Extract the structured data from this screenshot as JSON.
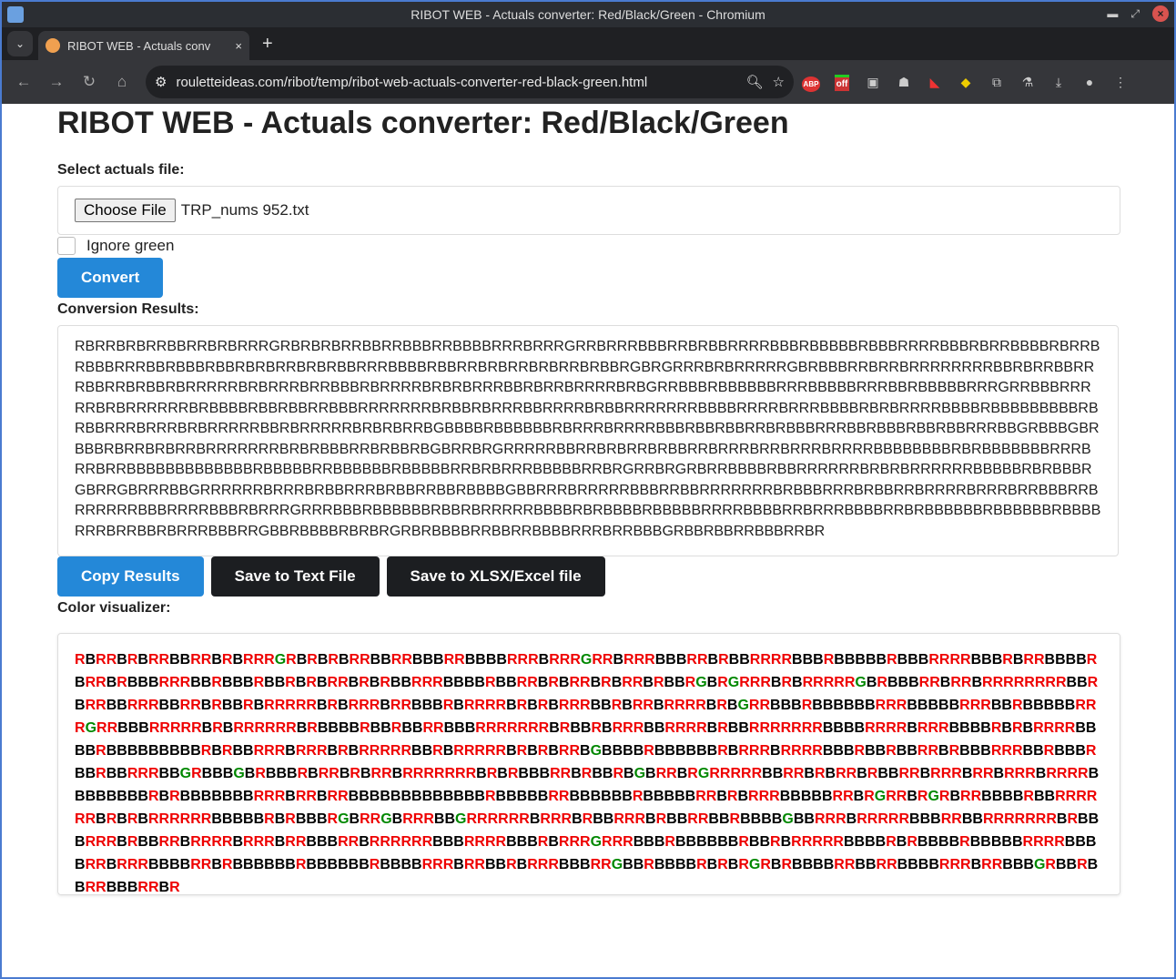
{
  "window": {
    "title": "RIBOT WEB - Actuals converter: Red/Black/Green - Chromium"
  },
  "tab": {
    "title": "RIBOT WEB - Actuals conv",
    "close": "×",
    "new": "+"
  },
  "toolbar": {
    "url": "rouletteideas.com/ribot/temp/ribot-web-actuals-converter-red-black-green.html",
    "extensions": [
      "ABP",
      "off"
    ]
  },
  "page": {
    "title": "RIBOT WEB - Actuals converter: Red/Black/Green",
    "select_label": "Select actuals file:",
    "choose_file": "Choose File",
    "file_name": "TRP_nums 952.txt",
    "ignore_green": "Ignore green",
    "ignore_green_checked": false,
    "convert": "Convert",
    "results_label": "Conversion Results:",
    "results": "RBRRBRBRRBBRRBRBRRRGRBRBRBRRBBRRBBBRRBBBBRRRBRRRGRRBRRRBBBRRBRBBRRRRBBBRBBBBBRBBBRRRRBBBRBRRBBBBRBRRBRBBBRRRBBRBBBRBBRBRBRRBRBRBBRRRBBBBRBBRRBRBRRBRBRRBRBBRGBRGRRRBRBRRRRRGBRBBBRRBRRBRRRRRRRRBBRBRRBBRRRBBRRBRBBRBRRRRRBRBRRRBRRBBBRBRRRRBRBRBRRRBBRBRRBRRRRBRBGRRBBBRBBBBBBRRRBBBBBRRRBBRBBBBBRRRGRRBBBRRRRRBRBRRRRRRBRBBBBRBBRBBRRBBBRRRRRRRBRBBRBRRRBBRRRRBRBBRRRRRRRBBBBRRRRBRRRBBBBRBRBRRRRBBBBRBBBBBBBBBRBRBBRRRBRRRBRBRRRRRBBRBRRRRRBRBRBRRBGBBBBRBBBBBBRBRRRBRRRRBBBRBBRBBRRBRBBBRRRBBRBBBRBBRBBRRRBBGRBBBGBRBBBRBRRBRBRRBRRRRRRRBRBRBBBRRBRBBRBGBRRBRGRRRRRBBRRBRBRRBRBBRRBRRRBRRBRRRBRRRRBBBBBBBBRBRBBBBBBBRRRBRRBRRBBBBBBBBBBBBBRBBBBBRRBBBBBBRBBBBBRRBRBRRRBBBBBRRBRGRRBRGRBRRBBBBRBBRRRRRRBRBRBRRRRRRBBBBBRBRBBBRGBRRGBRRRBBGRRRRRRBRRRBRBBRRRBRBBRRBBRBBBBGBBRRRBRRRRRBBBRRBBRRRRRRRBRBBBRRRBRBBRRBRRRRBRRRBRRBBBRRBRRRRRRBBBRRRRBBBRBRRRGRRRBBBRBBBBBBRBBRBRRRRRBBBBRBRBBBBRBBBBBRRRRBBBBRRBRRRBBBBRRBRBBBBBBRBBBBBBRBBBBRRRBRRBBRBRRRBBBRRGBBRBBBBRBRBRGRBRBBBBRRBBRRBBBBRRRBRRBBBGRBBRBBRRBBBRRBR",
    "copy": "Copy Results",
    "save_text": "Save to Text File",
    "save_xlsx": "Save to XLSX/Excel file",
    "visualizer_label": "Color visualizer:",
    "colors": {
      "R": "#ee0000",
      "B": "#000000",
      "G": "#008800",
      "accent": "#2488d8"
    }
  }
}
